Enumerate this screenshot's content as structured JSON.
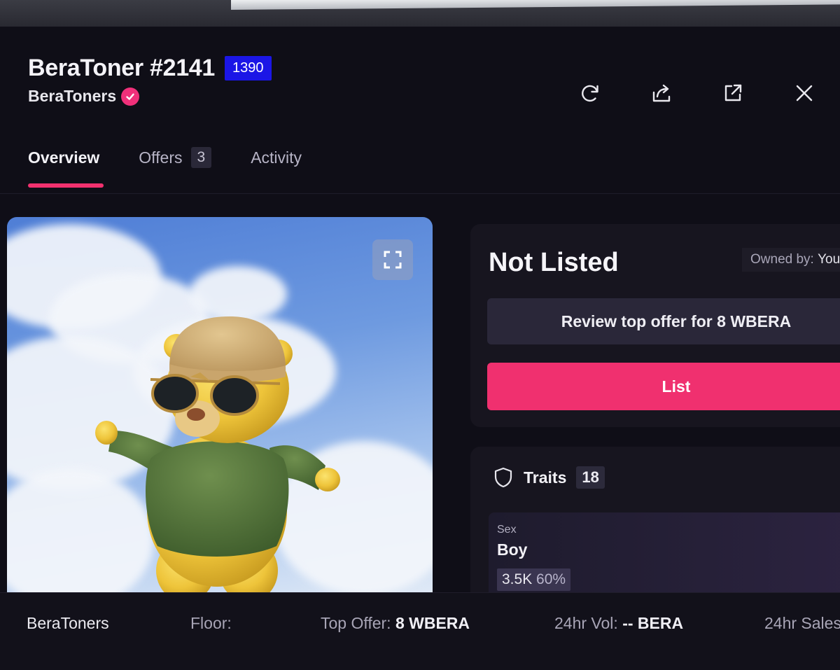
{
  "header": {
    "title": "BeraToner #2141",
    "rank": "1390",
    "collection": "BeraToners",
    "actions": [
      "refresh-icon",
      "share-icon",
      "external-link-icon",
      "close-icon"
    ]
  },
  "tabs": [
    {
      "label": "Overview",
      "active": true
    },
    {
      "label": "Offers",
      "count": "3"
    },
    {
      "label": "Activity"
    }
  ],
  "listing": {
    "status": "Not Listed",
    "owned_by_label": "Owned by:",
    "owned_by_value": "You",
    "review_offer_label": "Review top offer for 8 WBERA",
    "list_label": "List"
  },
  "traits": {
    "title": "Traits",
    "count": "18",
    "items": [
      {
        "type": "Sex",
        "value": "Boy",
        "count": "3.5K",
        "percent": "60%"
      }
    ]
  },
  "footer": {
    "collection": "BeraToners",
    "floor_label": "Floor:",
    "top_offer_label": "Top Offer:",
    "top_offer_value": "8 WBERA",
    "vol_label": "24hr Vol:",
    "vol_value": "-- BERA",
    "sales_label": "24hr Sales"
  },
  "colors": {
    "accent": "#f0306f",
    "rank_badge": "#1b16e6",
    "background": "#0f0e17"
  }
}
